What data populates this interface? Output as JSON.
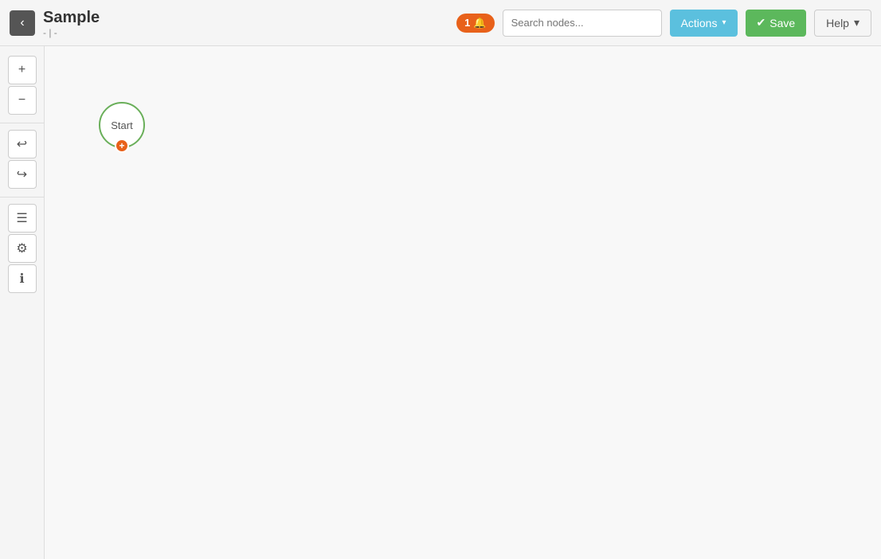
{
  "header": {
    "back_label": "‹",
    "title": "Sample",
    "subtitle": "- | -",
    "notification_count": "1",
    "bell_icon": "🔔",
    "search_placeholder": "Search nodes...",
    "actions_label": "Actions",
    "actions_caret": "▾",
    "save_label": "Save",
    "save_icon": "✔",
    "help_label": "Help",
    "help_caret": "▾"
  },
  "toolbar": {
    "zoom_in": "+",
    "zoom_out": "−",
    "undo": "↩",
    "redo": "↪",
    "list_icon": "☰",
    "settings_icon": "⚙",
    "info_icon": "ℹ"
  },
  "canvas": {
    "start_node_label": "Start",
    "start_add_icon": "+"
  }
}
